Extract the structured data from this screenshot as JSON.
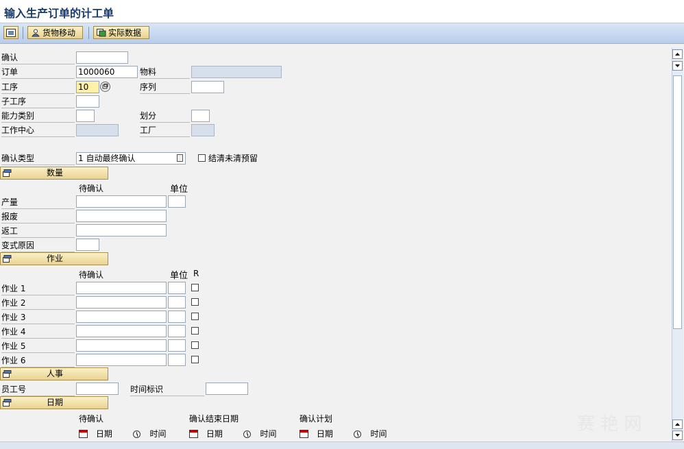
{
  "window": {
    "title": "输入生产订单的计工单"
  },
  "toolbar": {
    "goods_movement_label": "货物移动",
    "actual_data_label": "实际数据"
  },
  "header": {
    "confirmation_label": "确认",
    "confirmation_value": "",
    "order_label": "订单",
    "order_value": "1000060",
    "material_label": "物料",
    "material_value": "",
    "operation_label": "工序",
    "operation_value": "10",
    "sequence_label": "序列",
    "sequence_value": "",
    "suboperation_label": "子工序",
    "suboperation_value": "",
    "capacity_category_label": "能力类别",
    "capacity_category_value": "",
    "split_label": "划分",
    "split_value": "",
    "work_center_label": "工作中心",
    "work_center_value": "",
    "plant_label": "工厂",
    "plant_value": "",
    "confirmation_type_label": "确认类型",
    "confirmation_type_value": "1 自动最终确认",
    "clear_reservations_label": "结清未清预留"
  },
  "quantities": {
    "section_label": "数量",
    "col_to_confirm": "待确认",
    "col_unit": "单位",
    "yield_label": "产量",
    "scrap_label": "报废",
    "rework_label": "返工",
    "variance_reason_label": "变式原因"
  },
  "activities": {
    "section_label": "作业",
    "col_to_confirm": "待确认",
    "col_unit": "单位",
    "col_r": "R",
    "rows": [
      {
        "label": "作业 1"
      },
      {
        "label": "作业 2"
      },
      {
        "label": "作业 3"
      },
      {
        "label": "作业 4"
      },
      {
        "label": "作业 5"
      },
      {
        "label": "作业 6"
      }
    ]
  },
  "personnel": {
    "section_label": "人事",
    "personnel_number_label": "员工号",
    "time_id_label": "时间标识"
  },
  "dates": {
    "section_label": "日期",
    "col_to_confirm": "待确认",
    "col_confirmed_finish": "确认结束日期",
    "col_confirmed_plan": "确认计划",
    "date_label": "日期",
    "time_label": "时间"
  },
  "watermark": "赛 艳 网",
  "icons": {
    "overview": "window-icon",
    "goods_movement": "person-icon",
    "actual_data": "data-icon",
    "section": "collapse-icon",
    "calendar": "calendar-icon",
    "clock": "clock-icon"
  },
  "colors": {
    "toolbar": "#c6d8f0",
    "section_button": "#f0dca0",
    "title": "#1a3b6d",
    "readonly_field": "#d6dfeb",
    "highlight_field": "#fff1a8"
  }
}
